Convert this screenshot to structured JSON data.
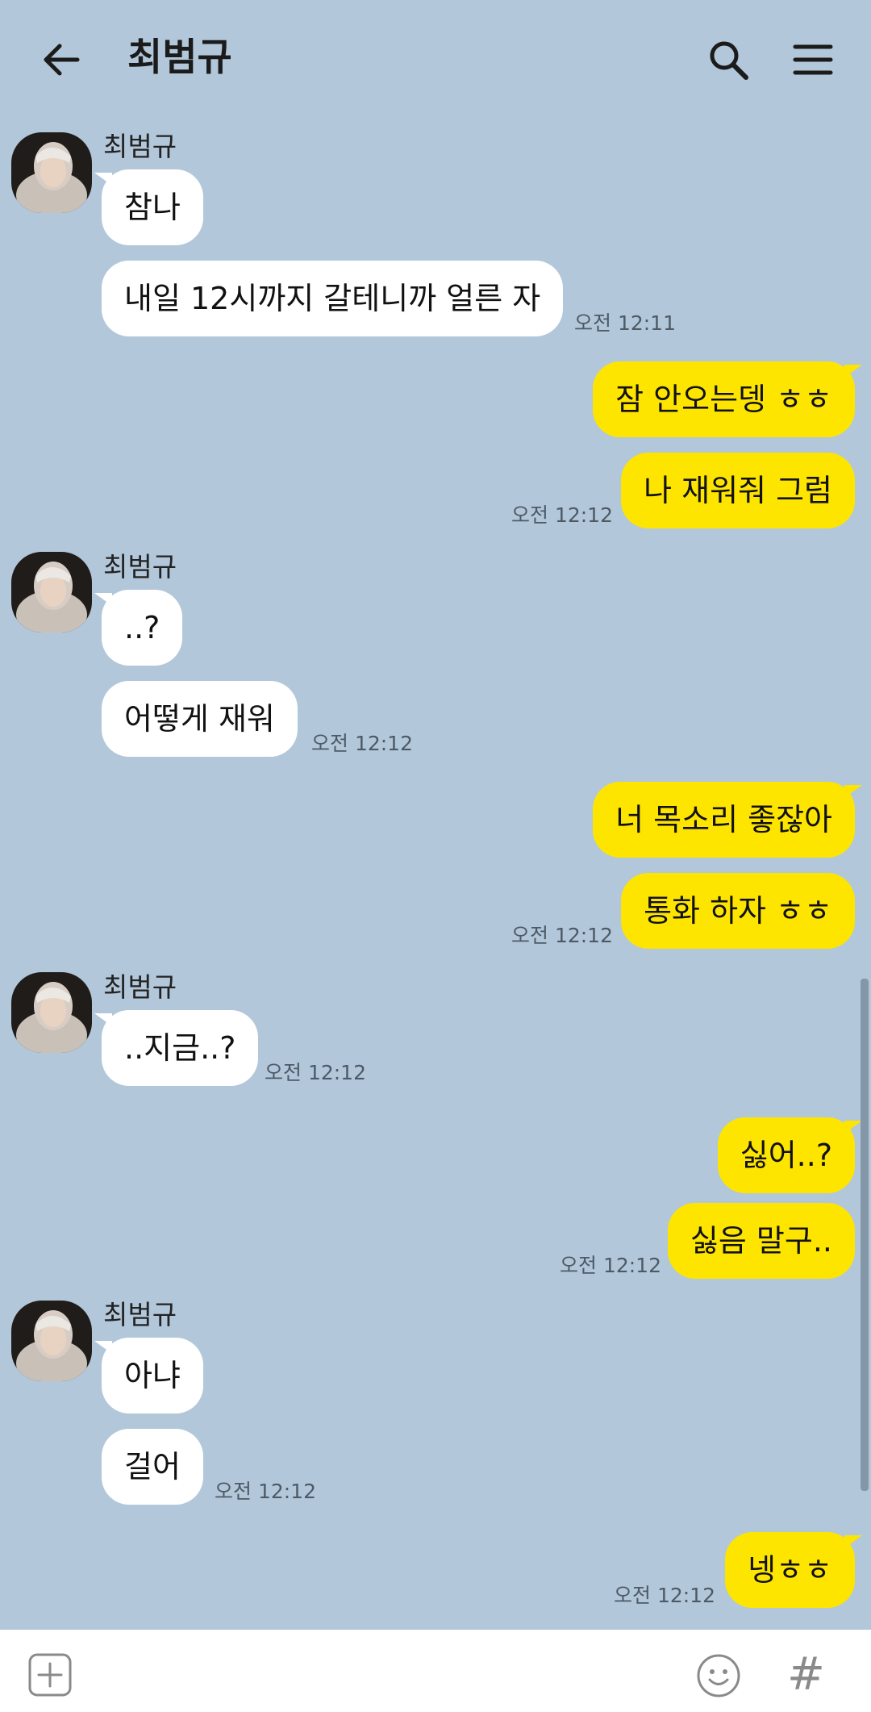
{
  "header": {
    "title": "최범규",
    "back_icon": "arrow-left-icon",
    "search_icon": "search-icon",
    "menu_icon": "menu-icon"
  },
  "messages": [
    {
      "sender": "최범규",
      "text": "참나"
    },
    {
      "text": "내일 12시까지 갈테니까 얼른 자",
      "time": "오전 12:11"
    },
    {
      "text": "잠 안오는뎅 ㅎㅎ"
    },
    {
      "text": "나 재워줘 그럼",
      "time": "오전 12:12"
    },
    {
      "sender": "최범규",
      "text": "..?"
    },
    {
      "text": "어떻게 재워",
      "time": "오전 12:12"
    },
    {
      "text": "너 목소리 좋잖아"
    },
    {
      "text": "통화 하자 ㅎㅎ",
      "time": "오전 12:12"
    },
    {
      "sender": "최범규",
      "text": "..지금..?",
      "time": "오전 12:12"
    },
    {
      "text": "싫어..?"
    },
    {
      "text": "싫음 말구..",
      "time": "오전 12:12"
    },
    {
      "sender": "최범규",
      "text": "아냐"
    },
    {
      "text": "걸어",
      "time": "오전 12:12"
    },
    {
      "text": "넹ㅎㅎ",
      "time": "오전 12:12"
    }
  ],
  "footer": {
    "hash_label": "#",
    "plus_icon": "plus-box-icon",
    "emoji_icon": "emoji-icon"
  },
  "colors": {
    "background": "#b2c7da",
    "bubble_in": "#ffffff",
    "bubble_out": "#fee500"
  }
}
